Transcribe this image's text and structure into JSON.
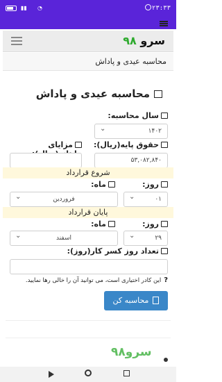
{
  "status": {
    "time": "۲۳:۳۳",
    "battery": "31"
  },
  "header": {
    "brand_text": "سرو",
    "brand_num": "۹۸"
  },
  "breadcrumb": "محاسبه عیدی و پاداش",
  "form": {
    "title": "محاسبه عیدی و پاداش",
    "year_label": "سال محاسبه:",
    "year_value": "۱۴۰۲",
    "base_salary_label": "حقوق پایه(ریال):",
    "base_salary_value": "۵۳,۰۸۲,۸۴۰",
    "benefits_label": "مزایای ماهانه(ریال):",
    "benefits_value": "",
    "contract_start_label": "شروع قرارداد",
    "day_label": "روز:",
    "month_label": "ماه:",
    "start_day_value": "۰۱",
    "start_month_value": "فروردین",
    "contract_end_label": "پایان قرارداد",
    "end_day_value": "۲۹",
    "end_month_value": "اسفند",
    "deduction_label": "تعداد روز کسر کار(روز):",
    "deduction_value": "",
    "note_mark": "?",
    "note_text": "این کادر اختیاری است، می توانید آن را خالی رها نمایید.",
    "calc_button": "محاسبه کن"
  },
  "watermark": {
    "brand_text": "سرو",
    "brand_num": "۹۸"
  },
  "colors": {
    "accent": "#5a24d9",
    "button": "#3a87c8",
    "brand_green": "#2eaa2e",
    "band": "#fff8dc"
  }
}
